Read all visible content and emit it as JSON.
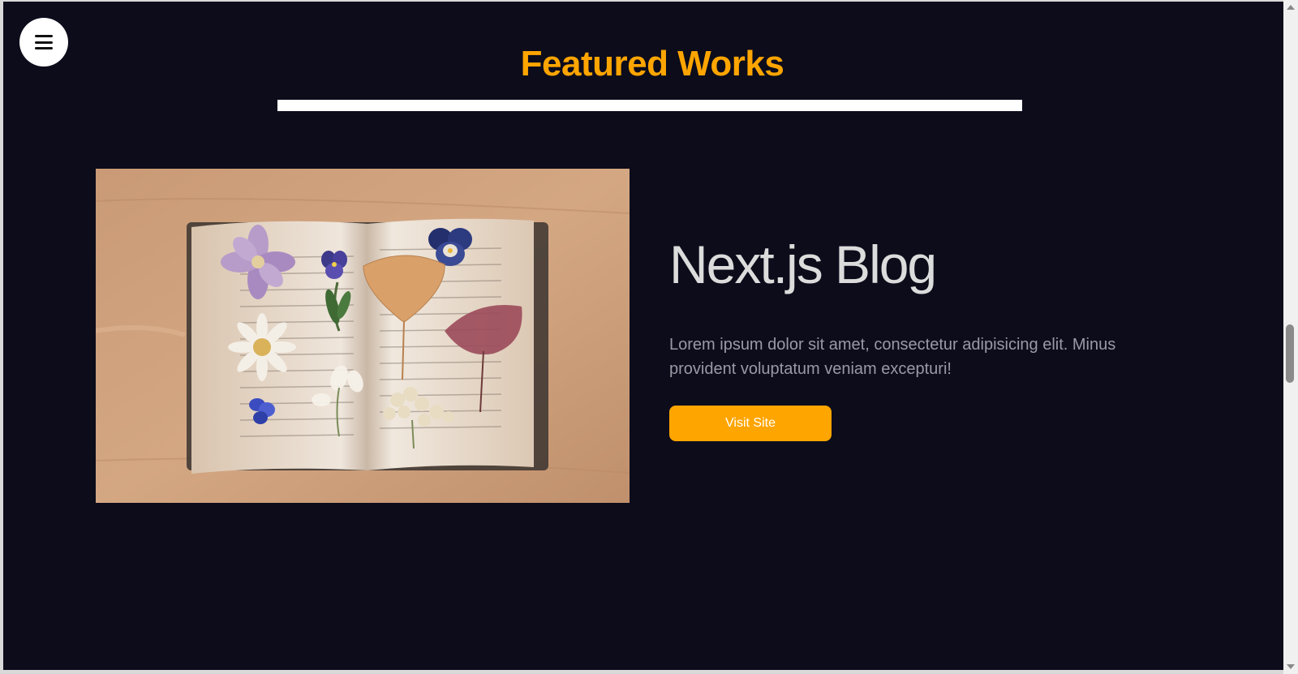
{
  "nav": {
    "menu_icon": "hamburger-menu-icon"
  },
  "section": {
    "title": "Featured Works"
  },
  "work": {
    "title": "Next.js Blog",
    "description": "Lorem ipsum dolor sit amet, consectetur adipisicing elit. Minus provident voluptatum veniam excepturi!",
    "button_label": "Visit Site",
    "image_alt": "open book with pressed flowers"
  },
  "colors": {
    "background": "#0c0c1b",
    "accent": "#ffa500",
    "title_text": "#dcdcdc",
    "body_text": "#9a9aa6"
  }
}
